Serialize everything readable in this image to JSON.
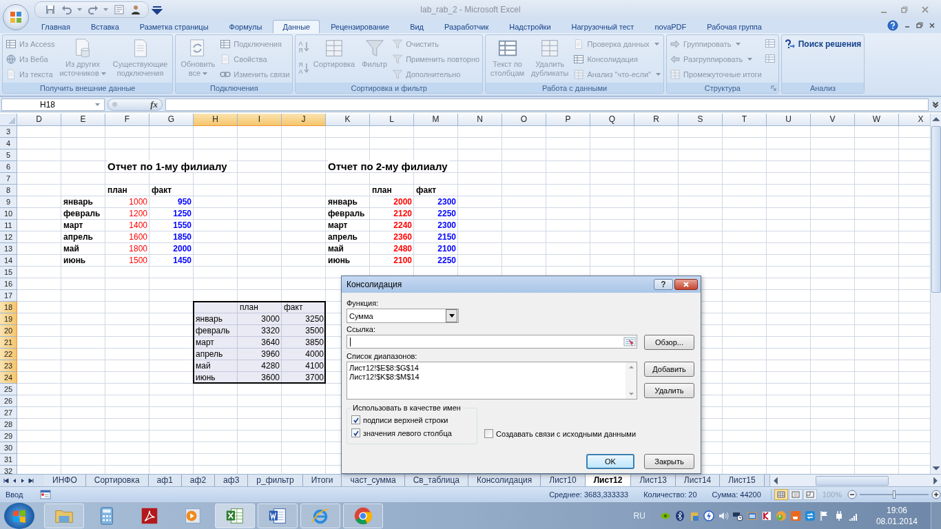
{
  "window": {
    "title": "lab_rab_2 - Microsoft Excel"
  },
  "ribbon_tabs": [
    {
      "label": "Главная",
      "selected": false
    },
    {
      "label": "Вставка",
      "selected": false
    },
    {
      "label": "Разметка страницы",
      "selected": false
    },
    {
      "label": "Формулы",
      "selected": false
    },
    {
      "label": "Данные",
      "selected": true
    },
    {
      "label": "Рецензирование",
      "selected": false
    },
    {
      "label": "Вид",
      "selected": false
    },
    {
      "label": "Разработчик",
      "selected": false
    },
    {
      "label": "Надстройки",
      "selected": false
    },
    {
      "label": "Нагрузочный тест",
      "selected": false
    },
    {
      "label": "novaPDF",
      "selected": false
    },
    {
      "label": "Рабочая группа",
      "selected": false
    }
  ],
  "ribbon_groups": [
    {
      "label": "Получить внешние данные",
      "launcher": false,
      "items": [
        {
          "kind": "small",
          "label": "Из Access",
          "disabled": true,
          "dropdown": false
        },
        {
          "kind": "small",
          "label": "Из Веба",
          "disabled": true,
          "dropdown": false
        },
        {
          "kind": "small",
          "label": "Из текста",
          "disabled": true,
          "dropdown": false
        },
        {
          "kind": "large",
          "label": "Из других\nисточников",
          "disabled": true,
          "dropdown": true
        },
        {
          "kind": "large",
          "label": "Существующие\nподключения",
          "disabled": true,
          "dropdown": false
        }
      ]
    },
    {
      "label": "Подключения",
      "launcher": false,
      "items": [
        {
          "kind": "large",
          "label": "Обновить\nвсе",
          "disabled": true,
          "dropdown": true
        },
        {
          "kind": "small",
          "label": "Подключения",
          "disabled": true,
          "dropdown": false
        },
        {
          "kind": "small",
          "label": "Свойства",
          "disabled": true,
          "dropdown": false
        },
        {
          "kind": "small",
          "label": "Изменить связи",
          "disabled": true,
          "dropdown": false
        }
      ]
    },
    {
      "label": "Сортировка и фильтр",
      "launcher": false,
      "items": [
        {
          "kind": "sort",
          "label": "А\nЯ",
          "disabled": true
        },
        {
          "kind": "sort",
          "label": "Я\nА",
          "disabled": true
        },
        {
          "kind": "large",
          "label": "Сортировка",
          "disabled": true,
          "dropdown": false
        },
        {
          "kind": "large",
          "label": "Фильтр",
          "disabled": true,
          "dropdown": false
        },
        {
          "kind": "small",
          "label": "Очистить",
          "disabled": true,
          "dropdown": false
        },
        {
          "kind": "small",
          "label": "Применить повторно",
          "disabled": true,
          "dropdown": false
        },
        {
          "kind": "small",
          "label": "Дополнительно",
          "disabled": true,
          "dropdown": false
        }
      ]
    },
    {
      "label": "Работа с данными",
      "launcher": false,
      "items": [
        {
          "kind": "large",
          "label": "Текст по\nстолбцам",
          "disabled": true,
          "dropdown": false
        },
        {
          "kind": "large",
          "label": "Удалить\nдубликаты",
          "disabled": true,
          "dropdown": false
        },
        {
          "kind": "small",
          "label": "Проверка данных",
          "disabled": true,
          "dropdown": true
        },
        {
          "kind": "small",
          "label": "Консолидация",
          "disabled": true,
          "dropdown": false
        },
        {
          "kind": "small",
          "label": "Анализ \"что-если\"",
          "disabled": true,
          "dropdown": true
        }
      ]
    },
    {
      "label": "Структура",
      "launcher": true,
      "items": [
        {
          "kind": "small",
          "label": "Группировать",
          "disabled": true,
          "dropdown": true
        },
        {
          "kind": "small",
          "label": "Разгруппировать",
          "disabled": true,
          "dropdown": true
        },
        {
          "kind": "small",
          "label": "Промежуточные итоги",
          "disabled": true,
          "dropdown": false
        },
        {
          "kind": "icon",
          "disabled": true
        },
        {
          "kind": "icon",
          "disabled": true
        }
      ]
    },
    {
      "label": "Анализ",
      "launcher": false,
      "items": [
        {
          "kind": "small",
          "label": "Поиск решения",
          "disabled": false,
          "dropdown": false
        }
      ]
    }
  ],
  "formula_bar": {
    "name_box": "H18",
    "fx": "fx"
  },
  "sheet": {
    "columns": [
      {
        "label": "D",
        "selected": false
      },
      {
        "label": "E",
        "selected": false
      },
      {
        "label": "F",
        "selected": false
      },
      {
        "label": "G",
        "selected": false
      },
      {
        "label": "H",
        "selected": true
      },
      {
        "label": "I",
        "selected": true
      },
      {
        "label": "J",
        "selected": true
      },
      {
        "label": "K",
        "selected": false
      },
      {
        "label": "L",
        "selected": false
      },
      {
        "label": "M",
        "selected": false
      },
      {
        "label": "N",
        "selected": false
      },
      {
        "label": "O",
        "selected": false
      },
      {
        "label": "P",
        "selected": false
      },
      {
        "label": "Q",
        "selected": false
      },
      {
        "label": "R",
        "selected": false
      },
      {
        "label": "S",
        "selected": false
      },
      {
        "label": "T",
        "selected": false
      },
      {
        "label": "U",
        "selected": false
      },
      {
        "label": "V",
        "selected": false
      },
      {
        "label": "W",
        "selected": false
      },
      {
        "label": "X",
        "selected": false
      }
    ],
    "rows": [
      {
        "label": "3",
        "selected": false,
        "cells": []
      },
      {
        "label": "4",
        "selected": false,
        "cells": []
      },
      {
        "label": "5",
        "selected": false,
        "cells": []
      },
      {
        "label": "6",
        "selected": false,
        "cells": [
          "",
          "",
          {
            "kind": "title",
            "text": "Отчет по 1-му филиалу"
          },
          "",
          "",
          "",
          "",
          {
            "kind": "title",
            "text": "Отчет по 2-му филиалу"
          }
        ]
      },
      {
        "label": "7",
        "selected": false,
        "cells": []
      },
      {
        "label": "8",
        "selected": false,
        "cells": [
          "",
          "",
          {
            "kind": "header",
            "text": "план"
          },
          {
            "kind": "header",
            "text": "факт"
          },
          "",
          "",
          "",
          "",
          {
            "kind": "header",
            "text": "план"
          },
          {
            "kind": "header",
            "text": "факт"
          }
        ]
      },
      {
        "label": "9",
        "selected": false,
        "cells": [
          "",
          {
            "kind": "header",
            "text": "январь"
          },
          {
            "kind": "number",
            "text": "1000",
            "bold": false,
            "color": "#ff0000"
          },
          {
            "kind": "number",
            "text": "950",
            "bold": true,
            "color": "#0000ff"
          },
          "",
          "",
          "",
          {
            "kind": "header",
            "text": "январь"
          },
          {
            "kind": "number",
            "text": "2000",
            "bold": true,
            "color": "#ff0000"
          },
          {
            "kind": "number",
            "text": "2300",
            "bold": true,
            "color": "#0000ff"
          }
        ]
      },
      {
        "label": "10",
        "selected": false,
        "cells": [
          "",
          {
            "kind": "header",
            "text": "февраль"
          },
          {
            "kind": "number",
            "text": "1200",
            "bold": false,
            "color": "#ff0000"
          },
          {
            "kind": "number",
            "text": "1250",
            "bold": true,
            "color": "#0000ff"
          },
          "",
          "",
          "",
          {
            "kind": "header",
            "text": "февраль"
          },
          {
            "kind": "number",
            "text": "2120",
            "bold": true,
            "color": "#ff0000"
          },
          {
            "kind": "number",
            "text": "2250",
            "bold": true,
            "color": "#0000ff"
          }
        ]
      },
      {
        "label": "11",
        "selected": false,
        "cells": [
          "",
          {
            "kind": "header",
            "text": "март"
          },
          {
            "kind": "number",
            "text": "1400",
            "bold": false,
            "color": "#ff0000"
          },
          {
            "kind": "number",
            "text": "1550",
            "bold": true,
            "color": "#0000ff"
          },
          "",
          "",
          "",
          {
            "kind": "header",
            "text": "март"
          },
          {
            "kind": "number",
            "text": "2240",
            "bold": true,
            "color": "#ff0000"
          },
          {
            "kind": "number",
            "text": "2300",
            "bold": true,
            "color": "#0000ff"
          }
        ]
      },
      {
        "label": "12",
        "selected": false,
        "cells": [
          "",
          {
            "kind": "header",
            "text": "апрель"
          },
          {
            "kind": "number",
            "text": "1600",
            "bold": false,
            "color": "#ff0000"
          },
          {
            "kind": "number",
            "text": "1850",
            "bold": true,
            "color": "#0000ff"
          },
          "",
          "",
          "",
          {
            "kind": "header",
            "text": "апрель"
          },
          {
            "kind": "number",
            "text": "2360",
            "bold": true,
            "color": "#ff0000"
          },
          {
            "kind": "number",
            "text": "2150",
            "bold": true,
            "color": "#0000ff"
          }
        ]
      },
      {
        "label": "13",
        "selected": false,
        "cells": [
          "",
          {
            "kind": "header",
            "text": "май"
          },
          {
            "kind": "number",
            "text": "1800",
            "bold": false,
            "color": "#ff0000"
          },
          {
            "kind": "number",
            "text": "2000",
            "bold": true,
            "color": "#0000ff"
          },
          "",
          "",
          "",
          {
            "kind": "header",
            "text": "май"
          },
          {
            "kind": "number",
            "text": "2480",
            "bold": true,
            "color": "#ff0000"
          },
          {
            "kind": "number",
            "text": "2100",
            "bold": true,
            "color": "#0000ff"
          }
        ]
      },
      {
        "label": "14",
        "selected": false,
        "cells": [
          "",
          {
            "kind": "header",
            "text": "июнь"
          },
          {
            "kind": "number",
            "text": "1500",
            "bold": false,
            "color": "#ff0000"
          },
          {
            "kind": "number",
            "text": "1450",
            "bold": true,
            "color": "#0000ff"
          },
          "",
          "",
          "",
          {
            "kind": "header",
            "text": "июнь"
          },
          {
            "kind": "number",
            "text": "2100",
            "bold": true,
            "color": "#ff0000"
          },
          {
            "kind": "number",
            "text": "2250",
            "bold": true,
            "color": "#0000ff"
          }
        ]
      },
      {
        "label": "15",
        "selected": false,
        "cells": []
      },
      {
        "label": "16",
        "selected": false,
        "cells": []
      },
      {
        "label": "17",
        "selected": false,
        "cells": []
      },
      {
        "label": "18",
        "selected": true,
        "cells": [
          "",
          "",
          "",
          "",
          "",
          {
            "kind": "text",
            "text": "план"
          },
          {
            "kind": "text",
            "text": "факт"
          }
        ]
      },
      {
        "label": "19",
        "selected": true,
        "cells": [
          "",
          "",
          "",
          "",
          {
            "kind": "text",
            "text": "январь"
          },
          {
            "kind": "number",
            "text": "3000",
            "bold": false
          },
          {
            "kind": "number",
            "text": "3250",
            "bold": false
          }
        ]
      },
      {
        "label": "20",
        "selected": true,
        "cells": [
          "",
          "",
          "",
          "",
          {
            "kind": "text",
            "text": "февраль"
          },
          {
            "kind": "number",
            "text": "3320",
            "bold": false
          },
          {
            "kind": "number",
            "text": "3500",
            "bold": false
          }
        ]
      },
      {
        "label": "21",
        "selected": true,
        "cells": [
          "",
          "",
          "",
          "",
          {
            "kind": "text",
            "text": "март"
          },
          {
            "kind": "number",
            "text": "3640",
            "bold": false
          },
          {
            "kind": "number",
            "text": "3850",
            "bold": false
          }
        ]
      },
      {
        "label": "22",
        "selected": true,
        "cells": [
          "",
          "",
          "",
          "",
          {
            "kind": "text",
            "text": "апрель"
          },
          {
            "kind": "number",
            "text": "3960",
            "bold": false
          },
          {
            "kind": "number",
            "text": "4000",
            "bold": false
          }
        ]
      },
      {
        "label": "23",
        "selected": true,
        "cells": [
          "",
          "",
          "",
          "",
          {
            "kind": "text",
            "text": "май"
          },
          {
            "kind": "number",
            "text": "4280",
            "bold": false
          },
          {
            "kind": "number",
            "text": "4100",
            "bold": false
          }
        ]
      },
      {
        "label": "24",
        "selected": true,
        "cells": [
          "",
          "",
          "",
          "",
          {
            "kind": "text",
            "text": "июнь"
          },
          {
            "kind": "number",
            "text": "3600",
            "bold": false
          },
          {
            "kind": "number",
            "text": "3700",
            "bold": false
          }
        ]
      },
      {
        "label": "25",
        "selected": false,
        "cells": []
      },
      {
        "label": "26",
        "selected": false,
        "cells": []
      },
      {
        "label": "27",
        "selected": false,
        "cells": []
      },
      {
        "label": "28",
        "selected": false,
        "cells": []
      },
      {
        "label": "29",
        "selected": false,
        "cells": []
      },
      {
        "label": "30",
        "selected": false,
        "cells": []
      },
      {
        "label": "31",
        "selected": false,
        "cells": []
      },
      {
        "label": "32",
        "selected": false,
        "cells": []
      }
    ]
  },
  "dialog": {
    "title": "Консолидация",
    "help": "?",
    "function_label": "Функция:",
    "function_value": "Сумма",
    "reference_label": "Ссылка:",
    "browse_button": "Обзор...",
    "ranges_label": "Список диапазонов:",
    "ranges": [
      "Лист12!$E$8:$G$14",
      "Лист12!$K$8:$M$14"
    ],
    "add_button": "Добавить",
    "delete_button": "Удалить",
    "names_group": "Использовать в качестве имен",
    "options": [
      {
        "label": "подписи верхней строки",
        "checked": true
      },
      {
        "label": "значения левого столбца",
        "checked": true
      }
    ],
    "links_option": {
      "label": "Создавать связи с исходными данными",
      "checked": false
    },
    "ok_button": "OK",
    "close_button": "Закрыть"
  },
  "sheet_tabs": [
    {
      "label": "ИНФО",
      "selected": false
    },
    {
      "label": "Сортировка",
      "selected": false
    },
    {
      "label": "аф1",
      "selected": false
    },
    {
      "label": "аф2",
      "selected": false
    },
    {
      "label": "аф3",
      "selected": false
    },
    {
      "label": "р_фильтр",
      "selected": false
    },
    {
      "label": "Итоги",
      "selected": false
    },
    {
      "label": "част_сумма",
      "selected": false
    },
    {
      "label": "Св_таблица",
      "selected": false
    },
    {
      "label": "Консолидация",
      "selected": false
    },
    {
      "label": "Лист10",
      "selected": false
    },
    {
      "label": "Лист12",
      "selected": true
    },
    {
      "label": "Лист13",
      "selected": false
    },
    {
      "label": "Лист14",
      "selected": false
    },
    {
      "label": "Лист15",
      "selected": false
    }
  ],
  "status_bar": {
    "mode": "Ввод",
    "stats": [
      "Среднее: 3683,333333",
      "Количество: 20",
      "Сумма: 44200"
    ],
    "views": [
      {
        "selected": true
      },
      {
        "selected": false
      },
      {
        "selected": false
      }
    ],
    "zoom": "100%",
    "zoom_level": {
      "level": 0.5
    }
  },
  "taskbar": {
    "apps": [
      {
        "running": true,
        "active": false
      },
      {
        "running": false,
        "active": false
      },
      {
        "running": false,
        "active": false
      },
      {
        "running": false,
        "active": false
      },
      {
        "running": true,
        "active": true
      },
      {
        "running": true,
        "active": false
      },
      {
        "running": true,
        "active": false
      },
      {
        "running": true,
        "active": false
      }
    ],
    "language": "RU",
    "time": "19:06",
    "date": "08.01.2014"
  }
}
